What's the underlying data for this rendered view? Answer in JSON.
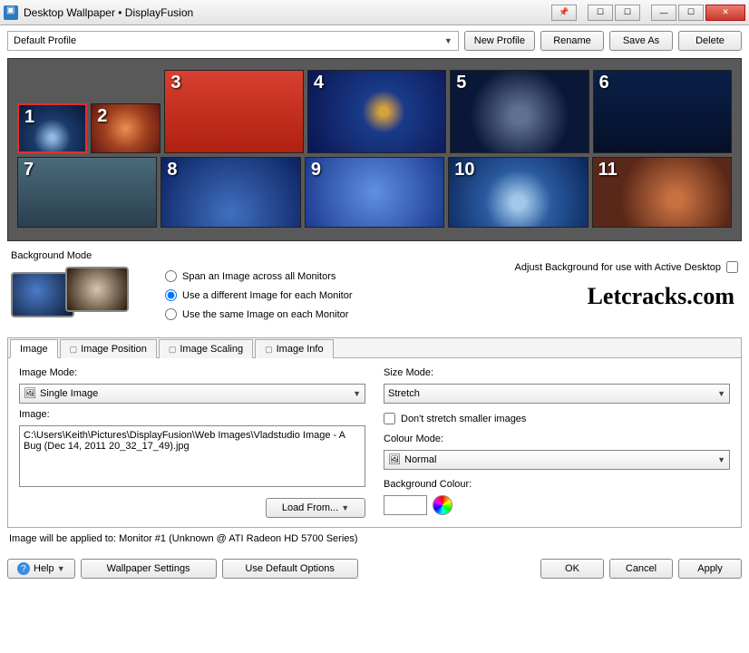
{
  "window": {
    "title": "Desktop Wallpaper • DisplayFusion"
  },
  "profile": {
    "selected": "Default Profile",
    "new_btn": "New Profile",
    "rename_btn": "Rename",
    "saveas_btn": "Save As",
    "delete_btn": "Delete"
  },
  "monitors": {
    "row1": [
      "1",
      "2",
      "3",
      "4",
      "5",
      "6"
    ],
    "row2": [
      "7",
      "8",
      "9",
      "10",
      "11"
    ]
  },
  "bgmode": {
    "heading": "Background Mode",
    "opt_span": "Span an Image across all Monitors",
    "opt_diff": "Use a different Image for each Monitor",
    "opt_same": "Use the same Image on each Monitor",
    "adjust_label": "Adjust Background for use with Active Desktop"
  },
  "watermark": "Letcracks.com",
  "tabs": {
    "image": "Image",
    "pos": "Image Position",
    "scale": "Image Scaling",
    "info": "Image Info"
  },
  "form": {
    "image_mode_label": "Image Mode:",
    "image_mode_value": "Single Image",
    "image_label": "Image:",
    "image_path": "C:\\Users\\Keith\\Pictures\\DisplayFusion\\Web Images\\Vladstudio Image - A Bug (Dec 14, 2011 20_32_17_49).jpg",
    "load_btn": "Load From...",
    "size_mode_label": "Size Mode:",
    "size_mode_value": "Stretch",
    "dont_stretch": "Don't stretch smaller images",
    "colour_mode_label": "Colour Mode:",
    "colour_mode_value": "Normal",
    "bg_colour_label": "Background Colour:"
  },
  "status": "Image will be applied to: Monitor #1 (Unknown @ ATI Radeon HD 5700 Series)",
  "bottom": {
    "help": "Help",
    "wallpaper_settings": "Wallpaper Settings",
    "use_defaults": "Use Default Options",
    "ok": "OK",
    "cancel": "Cancel",
    "apply": "Apply"
  }
}
